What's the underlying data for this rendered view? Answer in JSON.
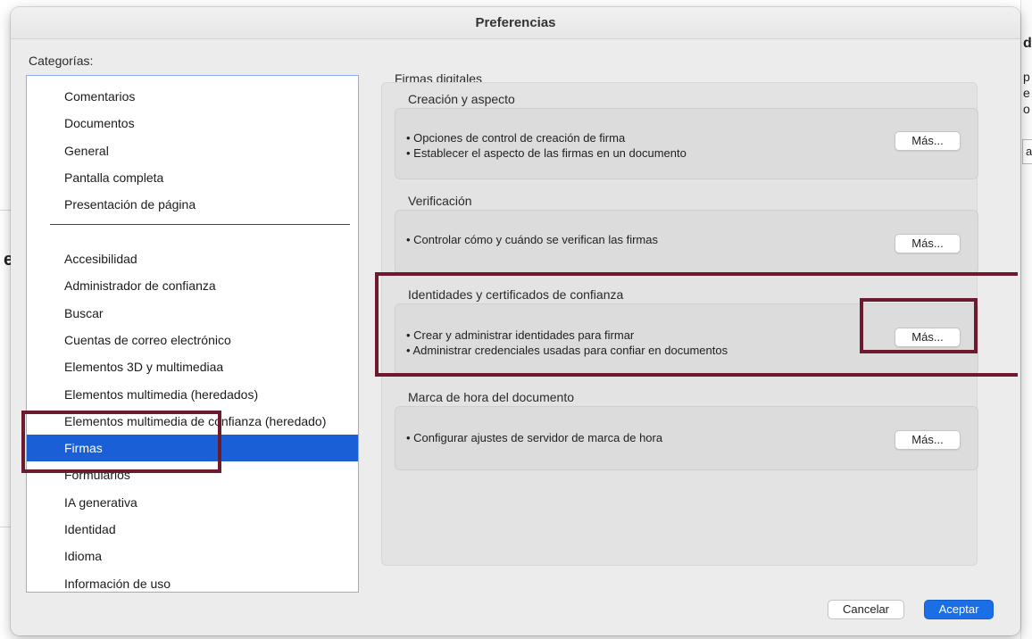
{
  "dialog": {
    "title": "Preferencias",
    "categories_label": "Categorías:",
    "categories_top": [
      {
        "label": "Comentarios"
      },
      {
        "label": "Documentos"
      },
      {
        "label": "General"
      },
      {
        "label": "Pantalla completa"
      },
      {
        "label": "Presentación de página"
      }
    ],
    "categories_bottom": [
      {
        "label": "Accesibilidad"
      },
      {
        "label": "Administrador de confianza"
      },
      {
        "label": "Buscar"
      },
      {
        "label": "Cuentas de correo electrónico"
      },
      {
        "label": "Elementos 3D y multimediaa"
      },
      {
        "label": "Elementos multimedia (heredados)"
      },
      {
        "label": "Elementos multimedia de confianza (heredado)"
      },
      {
        "label": "Firmas",
        "selected": true
      },
      {
        "label": "Formularios"
      },
      {
        "label": "IA generativa"
      },
      {
        "label": "Identidad"
      },
      {
        "label": "Idioma"
      },
      {
        "label": "Información de uso"
      }
    ],
    "section_title": "Firmas digitales",
    "groups": [
      {
        "label": "Creación y aspecto",
        "lines": [
          "• Opciones de control de creación de firma",
          "• Establecer el aspecto de las firmas en un documento"
        ],
        "button": "Más..."
      },
      {
        "label": "Verificación",
        "lines": [
          "• Controlar cómo y cuándo se verifican las firmas"
        ],
        "button": "Más..."
      },
      {
        "label": "Identidades y certificados de confianza",
        "lines": [
          "• Crear y administrar identidades para firmar",
          "• Administrar credenciales usadas para confiar en documentos"
        ],
        "button": "Más..."
      },
      {
        "label": "Marca de hora del documento",
        "lines": [
          "• Configurar ajustes de servidor de marca de hora"
        ],
        "button": "Más..."
      }
    ],
    "cancel_label": "Cancelar",
    "ok_label": "Aceptar"
  },
  "background": {
    "right_fragments": [
      "d",
      "p",
      "e",
      "o",
      "a"
    ],
    "left_fragment": "e"
  },
  "colors": {
    "selection": "#1a5fd6",
    "annotation": "#6b1b2d",
    "primary_button": "#1a6ee6"
  }
}
